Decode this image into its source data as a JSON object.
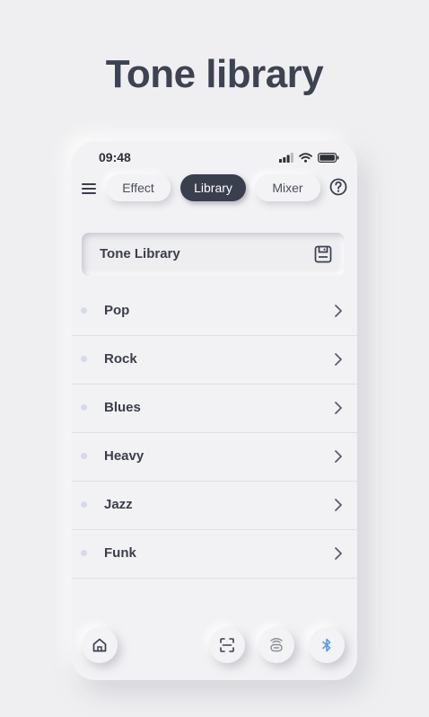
{
  "headline": "Tone library",
  "status_bar": {
    "time": "09:48",
    "icons": [
      "signal-icon",
      "wifi-icon",
      "battery-icon"
    ]
  },
  "header": {
    "menu_icon": "menu-icon",
    "help_icon": "help-icon",
    "tabs": [
      {
        "label": "Effect",
        "active": false
      },
      {
        "label": "Library",
        "active": true
      },
      {
        "label": "Mixer",
        "active": false
      }
    ]
  },
  "library_box": {
    "title": "Tone Library",
    "icon": "save-icon"
  },
  "categories": [
    {
      "label": "Pop"
    },
    {
      "label": "Rock"
    },
    {
      "label": "Blues"
    },
    {
      "label": "Heavy"
    },
    {
      "label": "Jazz"
    },
    {
      "label": "Funk"
    }
  ],
  "bottom_bar": {
    "buttons": [
      "home-icon",
      "scan-icon",
      "amp-icon",
      "bluetooth-icon"
    ]
  },
  "colors": {
    "background": "#efeff1",
    "accent_dark": "#3a3f4e",
    "bluetooth_blue": "#5b9be0",
    "text": "#3b3f4a"
  }
}
